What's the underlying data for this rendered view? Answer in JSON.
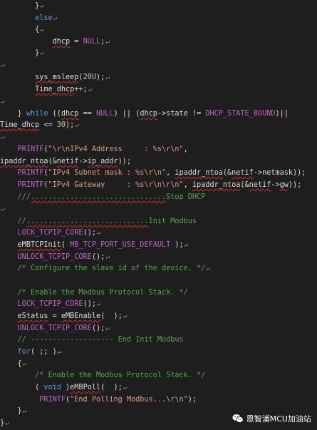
{
  "pilcrow": "↵",
  "lines": [
    {
      "text": "        }",
      "pm": true,
      "tokens": [
        {
          "t": "        }",
          "c": "ident"
        }
      ]
    },
    {
      "pm": true,
      "tokens": [
        {
          "t": "        ",
          "c": "ident"
        },
        {
          "t": "else",
          "c": "kw"
        }
      ]
    },
    {
      "pm": true,
      "tokens": [
        {
          "t": "        {",
          "c": "ident"
        }
      ]
    },
    {
      "pm": true,
      "tokens": [
        {
          "t": "            ",
          "c": "ident"
        },
        {
          "t": "dhcp",
          "c": "ident",
          "sq": true
        },
        {
          "t": " = ",
          "c": "ident"
        },
        {
          "t": "NULL",
          "c": "mac"
        },
        {
          "t": ";",
          "c": "ident"
        }
      ]
    },
    {
      "pm": true,
      "tokens": [
        {
          "t": "        }",
          "c": "ident"
        }
      ]
    },
    {
      "pm": true,
      "tokens": []
    },
    {
      "pm": true,
      "tokens": [
        {
          "t": "        ",
          "c": "ident"
        },
        {
          "t": "sys_msleep",
          "c": "fn",
          "sq": true
        },
        {
          "t": "(",
          "c": "ident"
        },
        {
          "t": "20U",
          "c": "num"
        },
        {
          "t": ");",
          "c": "ident"
        }
      ]
    },
    {
      "pm": true,
      "tokens": [
        {
          "t": "        ",
          "c": "ident"
        },
        {
          "t": "Time_dhcp",
          "c": "ident",
          "sq": true
        },
        {
          "t": "++;",
          "c": "ident"
        }
      ]
    },
    {
      "pm": true,
      "tokens": []
    },
    {
      "pm": false,
      "tokens": [
        {
          "t": "    } ",
          "c": "ident"
        },
        {
          "t": "while",
          "c": "kw"
        },
        {
          "t": " ((",
          "c": "ident"
        },
        {
          "t": "dhcp",
          "c": "ident",
          "sq": true
        },
        {
          "t": " == ",
          "c": "ident"
        },
        {
          "t": "NULL",
          "c": "mac"
        },
        {
          "t": ") || (",
          "c": "ident"
        },
        {
          "t": "dhcp",
          "c": "ident",
          "sq": true
        },
        {
          "t": "->state != ",
          "c": "ident"
        },
        {
          "t": "DHCP_STATE_BOUND",
          "c": "mac"
        },
        {
          "t": ")||",
          "c": "ident"
        }
      ]
    },
    {
      "pm": true,
      "tokens": [
        {
          "t": "Time_dhcp",
          "c": "ident",
          "sq": true
        },
        {
          "t": " <= ",
          "c": "ident"
        },
        {
          "t": "30",
          "c": "num"
        },
        {
          "t": ");",
          "c": "ident"
        }
      ]
    },
    {
      "pm": true,
      "tokens": []
    },
    {
      "pm": false,
      "tokens": [
        {
          "t": "    ",
          "c": "ident"
        },
        {
          "t": "PRINTF",
          "c": "mac"
        },
        {
          "t": "(",
          "c": "ident"
        },
        {
          "t": "\"\\r\\nIPv4 Address     : %s\\r\\n\"",
          "c": "str"
        },
        {
          "t": ",",
          "c": "ident"
        }
      ]
    },
    {
      "pm": false,
      "tokens": [
        {
          "t": "ipaddr_ntoa",
          "c": "fn",
          "sq": true
        },
        {
          "t": "(&",
          "c": "ident"
        },
        {
          "t": "netif",
          "c": "ident",
          "sq": true
        },
        {
          "t": "->",
          "c": "ident"
        },
        {
          "t": "ip_addr",
          "c": "ident",
          "sq": true
        },
        {
          "t": "));",
          "c": "ident"
        }
      ]
    },
    {
      "pm": false,
      "tokens": [
        {
          "t": "    ",
          "c": "ident"
        },
        {
          "t": "PRINTF",
          "c": "mac"
        },
        {
          "t": "(",
          "c": "ident"
        },
        {
          "t": "\"IPv4 Subnet mask : %s\\r\\n\"",
          "c": "str"
        },
        {
          "t": ", ",
          "c": "ident"
        },
        {
          "t": "ipaddr_ntoa",
          "c": "fn",
          "sq": true
        },
        {
          "t": "(&",
          "c": "ident"
        },
        {
          "t": "netif",
          "c": "ident",
          "sq": true
        },
        {
          "t": "->netmask));",
          "c": "ident"
        }
      ]
    },
    {
      "pm": false,
      "tokens": [
        {
          "t": "    ",
          "c": "ident"
        },
        {
          "t": "PRINTF",
          "c": "mac"
        },
        {
          "t": "(",
          "c": "ident"
        },
        {
          "t": "\"IPv4 Gateway     : %s\\r\\n\\r\\n\"",
          "c": "str"
        },
        {
          "t": ", ",
          "c": "ident"
        },
        {
          "t": "ipaddr_ntoa",
          "c": "fn",
          "sq": true
        },
        {
          "t": "(&",
          "c": "ident"
        },
        {
          "t": "netif",
          "c": "ident",
          "sq": true
        },
        {
          "t": "->",
          "c": "ident"
        },
        {
          "t": "gw",
          "c": "ident",
          "sq": true
        },
        {
          "t": "));",
          "c": "ident"
        }
      ]
    },
    {
      "pm": false,
      "tokens": [
        {
          "t": "    ",
          "c": "ident"
        },
        {
          "t": "///",
          "c": "cm"
        },
        {
          "t": "...............................",
          "c": "cm",
          "sq": true
        },
        {
          "t": "Stop DHCP",
          "c": "cm"
        }
      ]
    },
    {
      "pm": true,
      "tokens": []
    },
    {
      "pm": false,
      "tokens": [
        {
          "t": "    ",
          "c": "ident"
        },
        {
          "t": "//",
          "c": "cm"
        },
        {
          "t": "............................",
          "c": "cm",
          "sq": true
        },
        {
          "t": "Init Modbus",
          "c": "cm"
        }
      ]
    },
    {
      "pm": true,
      "tokens": [
        {
          "t": "    ",
          "c": "ident"
        },
        {
          "t": "LOCK_TCPIP_CORE",
          "c": "mac"
        },
        {
          "t": "();",
          "c": "ident"
        }
      ]
    },
    {
      "pm": true,
      "tokens": [
        {
          "t": "    ",
          "c": "ident"
        },
        {
          "t": "eMBTCPInit",
          "c": "fn",
          "sq": true
        },
        {
          "t": "( ",
          "c": "ident"
        },
        {
          "t": "MB_TCP_PORT_USE_DEFAULT",
          "c": "mac"
        },
        {
          "t": " );",
          "c": "ident"
        }
      ]
    },
    {
      "pm": true,
      "tokens": [
        {
          "t": "    ",
          "c": "ident"
        },
        {
          "t": "UNLOCK_TCPIP_CORE",
          "c": "mac"
        },
        {
          "t": "();",
          "c": "ident"
        }
      ]
    },
    {
      "pm": true,
      "tokens": [
        {
          "t": "    ",
          "c": "ident"
        },
        {
          "t": "/* Configure the slave id of the device. */",
          "c": "cm"
        }
      ]
    },
    {
      "pm": false,
      "tokens": []
    },
    {
      "pm": false,
      "tokens": [
        {
          "t": "    ",
          "c": "ident"
        },
        {
          "t": "/* Enable the Modbus Protocol Stack. */",
          "c": "cm"
        }
      ]
    },
    {
      "pm": true,
      "tokens": [
        {
          "t": "    ",
          "c": "ident"
        },
        {
          "t": "LOCK_TCPIP_CORE",
          "c": "mac"
        },
        {
          "t": "();",
          "c": "ident"
        }
      ]
    },
    {
      "pm": true,
      "tokens": [
        {
          "t": "    ",
          "c": "ident"
        },
        {
          "t": "eStatus",
          "c": "ident",
          "sq": true
        },
        {
          "t": " = ",
          "c": "ident"
        },
        {
          "t": "eMBEnable",
          "c": "fn",
          "sq": true
        },
        {
          "t": "(  );",
          "c": "ident"
        }
      ]
    },
    {
      "pm": true,
      "tokens": [
        {
          "t": "    ",
          "c": "ident"
        },
        {
          "t": "UNLOCK_TCPIP_CORE",
          "c": "mac"
        },
        {
          "t": "();",
          "c": "ident"
        }
      ]
    },
    {
      "pm": false,
      "tokens": [
        {
          "t": "    ",
          "c": "ident"
        },
        {
          "t": "// ------------------- End Init Modbus",
          "c": "cm"
        }
      ]
    },
    {
      "pm": true,
      "tokens": [
        {
          "t": "    ",
          "c": "ident"
        },
        {
          "t": "for",
          "c": "kw"
        },
        {
          "t": "( ;; )",
          "c": "ident"
        }
      ]
    },
    {
      "pm": true,
      "tokens": [
        {
          "t": "    {",
          "c": "ident"
        }
      ]
    },
    {
      "pm": false,
      "tokens": [
        {
          "t": "        ",
          "c": "ident"
        },
        {
          "t": "/* Enable the Modbus Protocol Stack. */",
          "c": "cm"
        }
      ]
    },
    {
      "pm": true,
      "tokens": [
        {
          "t": "        ( ",
          "c": "ident"
        },
        {
          "t": "void",
          "c": "kw"
        },
        {
          "t": " )",
          "c": "ident"
        },
        {
          "t": "eMBPoll",
          "c": "fn",
          "sq": true
        },
        {
          "t": "(  );",
          "c": "ident"
        }
      ]
    },
    {
      "pm": false,
      "tokens": [
        {
          "t": "         ",
          "c": "ident"
        },
        {
          "t": "PRINTF",
          "c": "mac"
        },
        {
          "t": "(",
          "c": "ident"
        },
        {
          "t": "\"End Polling Modbus...\\r\\n\"",
          "c": "str"
        },
        {
          "t": ");",
          "c": "ident"
        }
      ]
    },
    {
      "pm": true,
      "tokens": [
        {
          "t": "    }",
          "c": "ident"
        }
      ]
    },
    {
      "pm": true,
      "tokens": [
        {
          "t": "}",
          "c": "ident"
        }
      ]
    }
  ],
  "watermark": {
    "icon": "wechat-icon",
    "text": "恩智浦MCU加油站"
  }
}
